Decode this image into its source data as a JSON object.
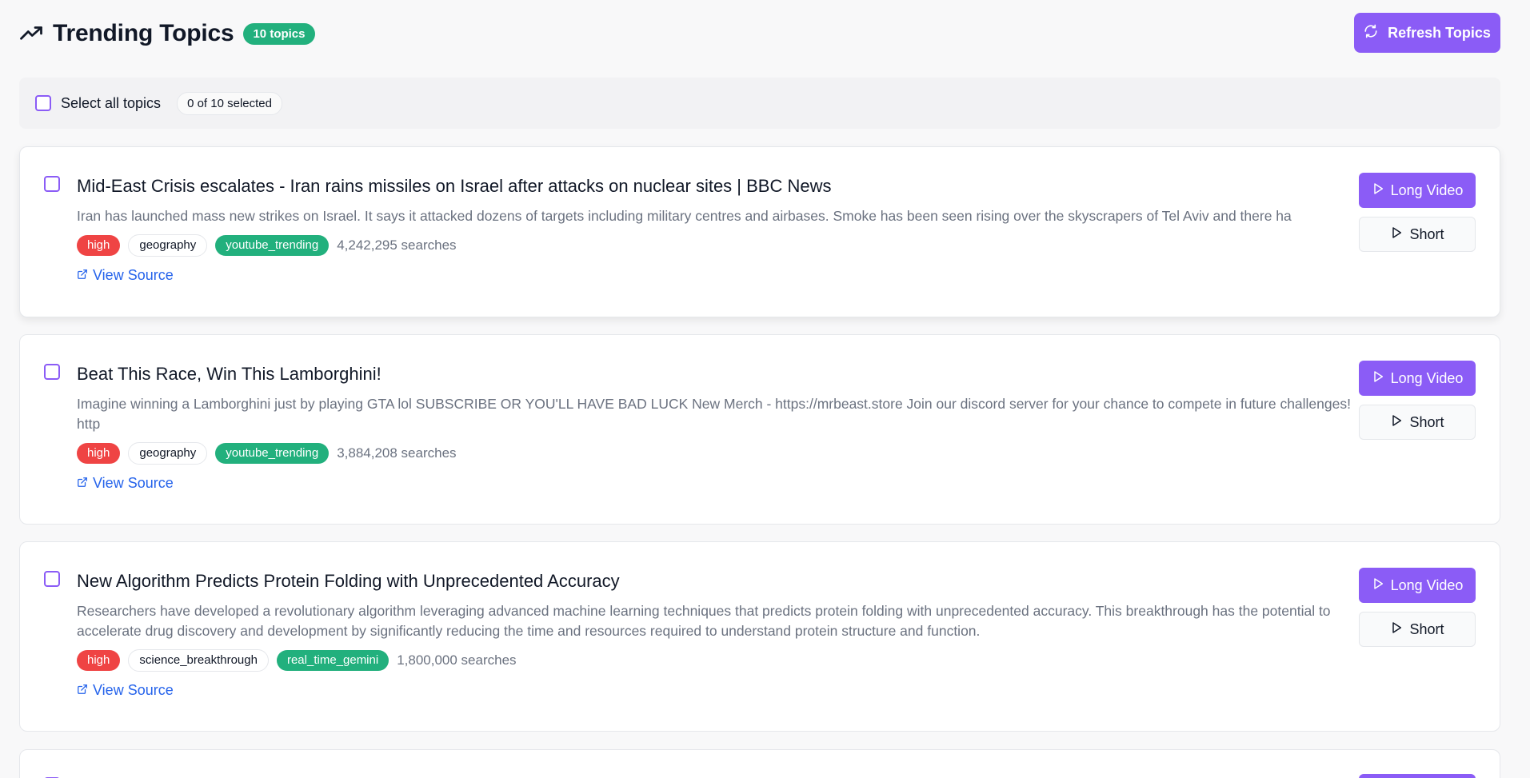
{
  "header": {
    "title": "Trending Topics",
    "count_badge": "10 topics",
    "refresh_label": "Refresh Topics",
    "icons": {
      "trend": "trending-up-icon",
      "refresh": "refresh-icon"
    }
  },
  "selection": {
    "label": "Select all topics",
    "count": "0 of 10 selected"
  },
  "actions": {
    "long_label": "Long Video",
    "short_label": "Short"
  },
  "colors": {
    "accent": "#8b5cf6",
    "priority_high": "#ef4444",
    "source_badge": "#22b07d",
    "link": "#2563eb"
  },
  "topics": [
    {
      "title": "Mid-East Crisis escalates - Iran rains missiles on Israel after attacks on nuclear sites | BBC News",
      "description": "Iran has launched mass new strikes on Israel. It says it attacked dozens of targets including military centres and airbases.   Smoke has been seen rising over the skyscrapers of Tel Aviv and there ha",
      "priority": "high",
      "category": "geography",
      "source": "youtube_trending",
      "searches": "4,242,295 searches",
      "source_link": "View Source"
    },
    {
      "title": "Beat This Race, Win This Lamborghini!",
      "description": "Imagine winning a Lamborghini just by playing GTA lol SUBSCRIBE OR YOU'LL HAVE BAD LUCK New Merch - https://mrbeast.store Join our discord server for your chance to compete in future challenges! http",
      "priority": "high",
      "category": "geography",
      "source": "youtube_trending",
      "searches": "3,884,208 searches",
      "source_link": "View Source"
    },
    {
      "title": "New Algorithm Predicts Protein Folding with Unprecedented Accuracy",
      "description": "Researchers have developed a revolutionary algorithm leveraging advanced machine learning techniques that predicts protein folding with unprecedented accuracy. This breakthrough has the potential to accelerate drug discovery and development by significantly reducing the time and resources required to understand protein structure and function.",
      "priority": "high",
      "category": "science_breakthrough",
      "source": "real_time_gemini",
      "searches": "1,800,000 searches",
      "source_link": "View Source"
    }
  ]
}
